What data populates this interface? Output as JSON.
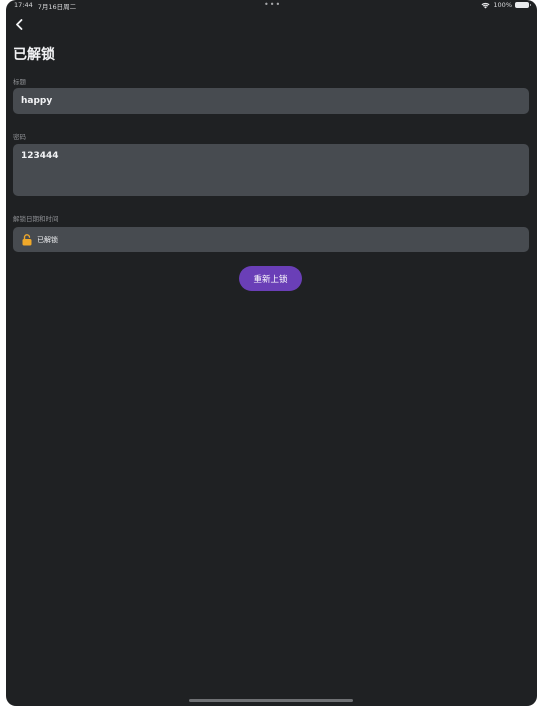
{
  "status_bar": {
    "time": "17:44",
    "date": "7月16日周二",
    "dots": "•••",
    "battery": "100%"
  },
  "page": {
    "title": "已解锁"
  },
  "fields": {
    "title_label": "标题",
    "title_value": "happy",
    "password_label": "密码",
    "password_value": "123444",
    "unlock_label": "解锁日期和时间",
    "unlock_value": "已解锁"
  },
  "actions": {
    "relock_label": "重新上锁"
  },
  "colors": {
    "background": "#1f2123",
    "field": "#474b50",
    "accent": "#6a3fb7",
    "lock_icon": "#f0a92a"
  },
  "icons": {
    "back": "chevron-left-icon",
    "lock": "unlocked-padlock-icon",
    "wifi": "wifi-icon",
    "battery": "battery-icon"
  }
}
